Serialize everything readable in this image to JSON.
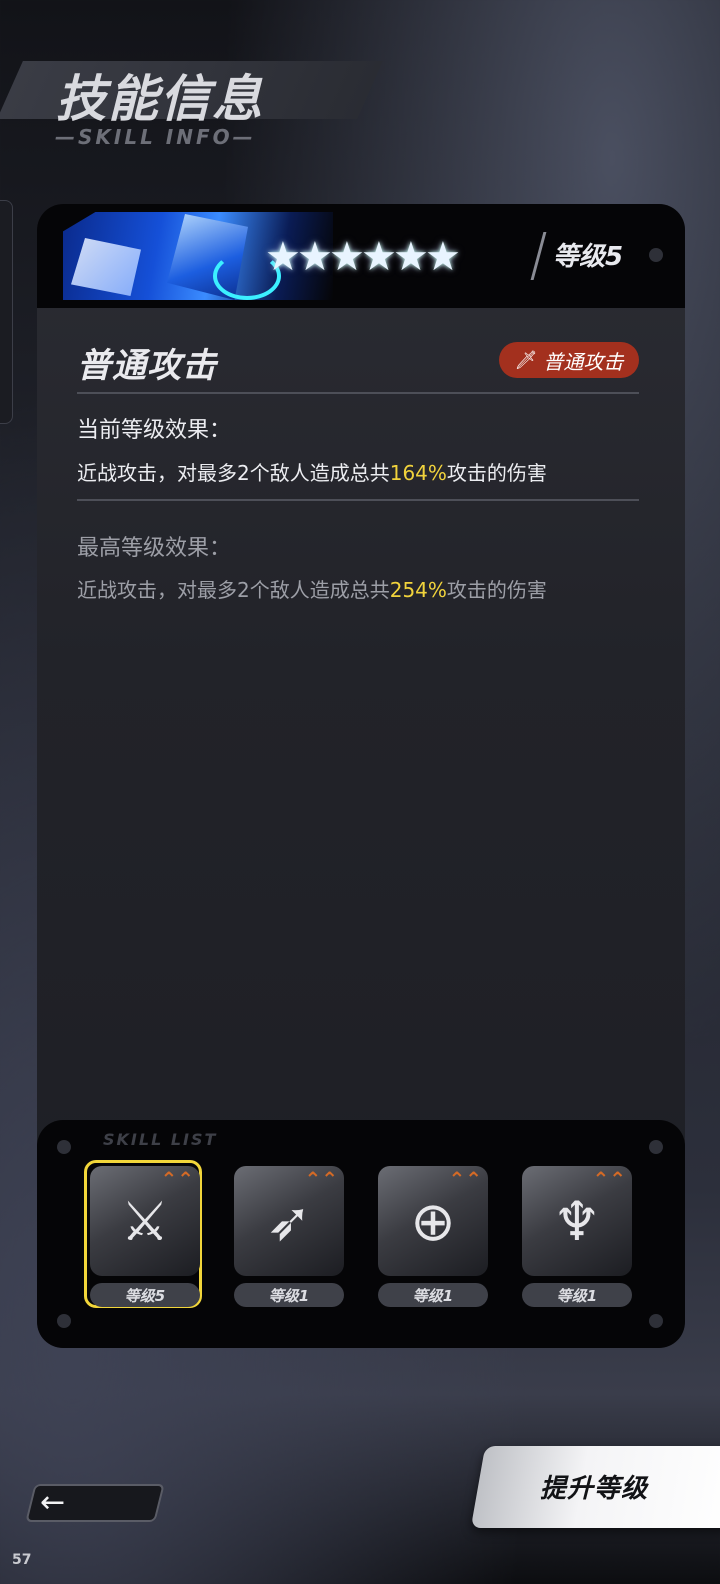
{
  "header": {
    "title": "技能信息",
    "subtitle": "—SKILL INFO—"
  },
  "skill_card": {
    "stars": [
      "★",
      "★",
      "★",
      "★",
      "★",
      "★"
    ],
    "level_label": "等级5",
    "skill_name": "普通攻击",
    "type_badge": {
      "icon": "sword-icon",
      "label": "普通攻击"
    },
    "current": {
      "heading": "当前等级效果：",
      "text_before": "近战攻击，对最多2个敌人造成总共",
      "highlight": "164%",
      "text_after": "攻击的伤害"
    },
    "max": {
      "heading": "最高等级效果：",
      "text_before": "近战攻击，对最多2个敌人造成总共",
      "highlight": "254%",
      "text_after": "攻击的伤害"
    },
    "highlight_color": "#f1d33c"
  },
  "skill_list": {
    "subtitle": "SKILL LIST",
    "slots": [
      {
        "icon": "spear-thrust-icon",
        "glyph": "⚔",
        "level": "等级5",
        "selected": true
      },
      {
        "icon": "blade-slash-icon",
        "glyph": "➶",
        "level": "等级1",
        "selected": false
      },
      {
        "icon": "target-spin-icon",
        "glyph": "⊕",
        "level": "等级1",
        "selected": false
      },
      {
        "icon": "claw-burst-icon",
        "glyph": "♆",
        "level": "等级1",
        "selected": false
      }
    ],
    "upgrade_indicator": "⌃⌃"
  },
  "footer": {
    "back_icon": "arrow-left-icon",
    "back_glyph": "←",
    "upgrade_label": "提升等级",
    "page_number": "57"
  }
}
